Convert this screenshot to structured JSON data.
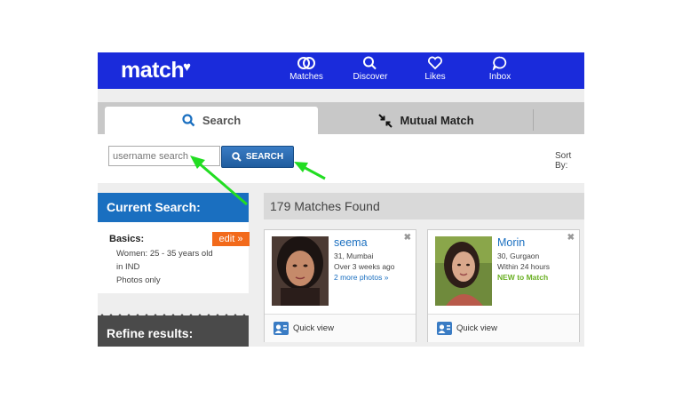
{
  "brand": {
    "name": "match",
    "color": "#1a2bdb",
    "accent": "#f26a1b"
  },
  "nav": [
    {
      "label": "Matches",
      "icon": "rings-icon"
    },
    {
      "label": "Discover",
      "icon": "search-icon"
    },
    {
      "label": "Likes",
      "icon": "heart-icon"
    },
    {
      "label": "Inbox",
      "icon": "chat-bubble-icon"
    }
  ],
  "tabs": [
    {
      "label": "Search",
      "icon": "search-icon",
      "active": true
    },
    {
      "label": "Mutual Match",
      "icon": "arrows-inward-icon",
      "active": false
    }
  ],
  "search": {
    "placeholder": "username search",
    "button_label": "SEARCH",
    "sort_label": "Sort By:"
  },
  "sidebar": {
    "current_search_title": "Current Search:",
    "basics_title": "Basics:",
    "edit_label": "edit »",
    "basics_lines": [
      "Women: 25 - 35 years old",
      "in IND",
      "Photos only"
    ],
    "refine_title": "Refine results:"
  },
  "results": {
    "header": "179 Matches Found",
    "cards": [
      {
        "name": "seema",
        "age_location": "31, Mumbai",
        "status": "Over 3 weeks ago",
        "extra": "2 more photos »",
        "extra_type": "link",
        "quick_view": "Quick view"
      },
      {
        "name": "Morin",
        "age_location": "30, Gurgaon",
        "status": "Within 24 hours",
        "extra": "NEW to Match",
        "extra_type": "new",
        "quick_view": "Quick view"
      }
    ]
  },
  "annotation_color": "#22dd22"
}
